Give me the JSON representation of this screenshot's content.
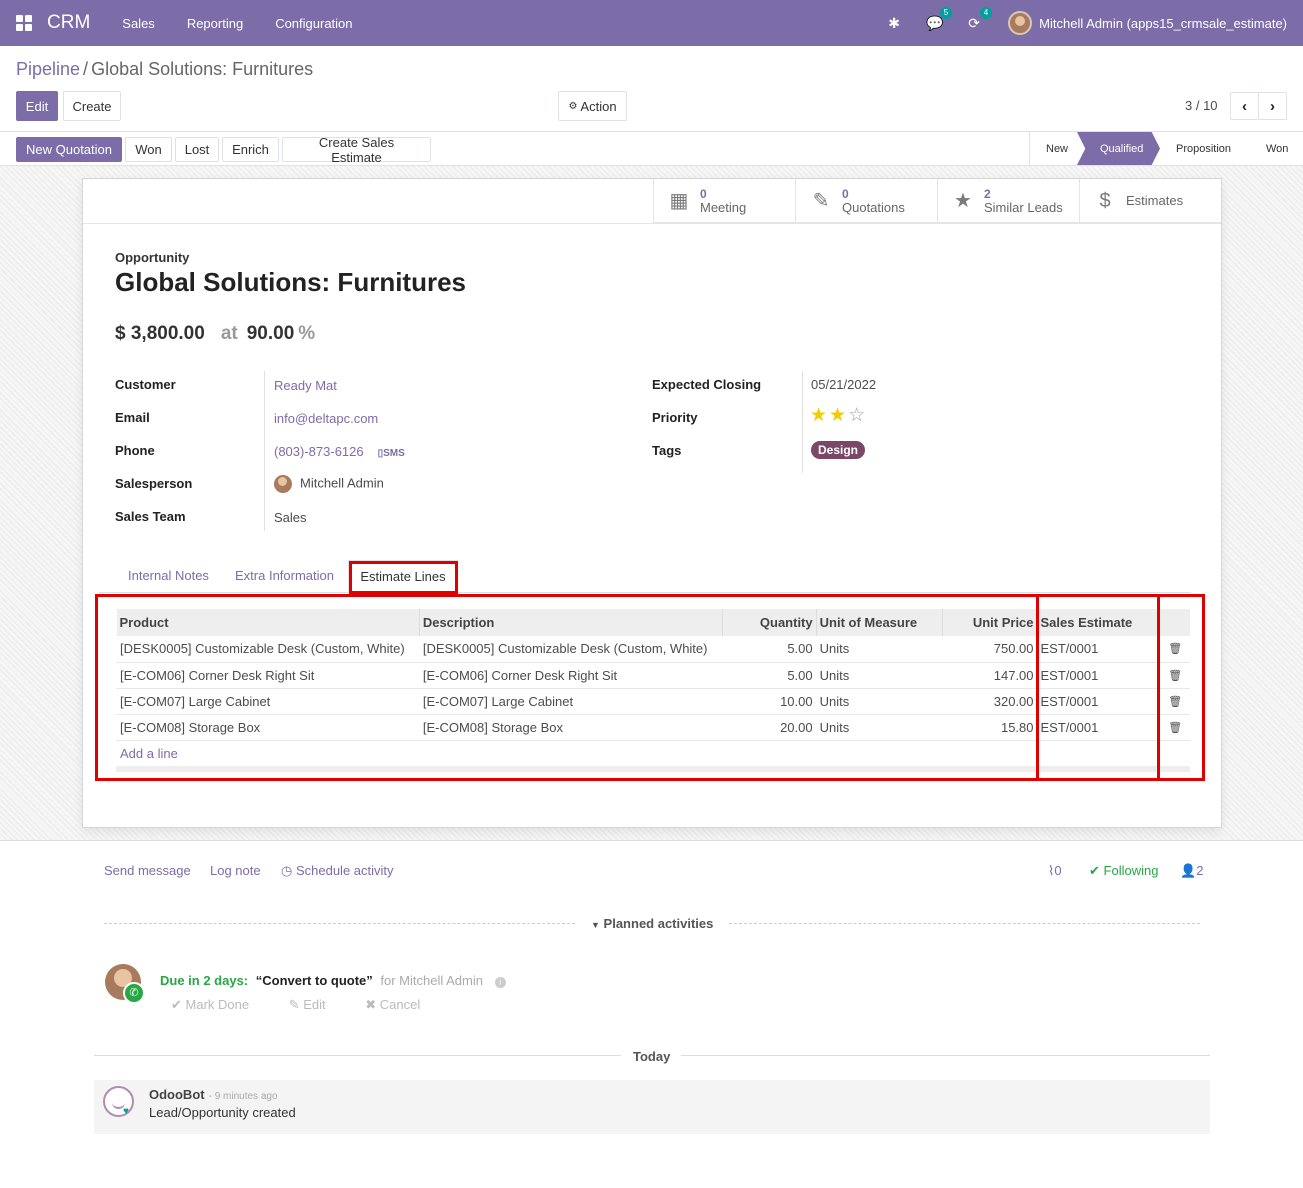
{
  "navbar": {
    "brand": "CRM",
    "menus": [
      "Sales",
      "Reporting",
      "Configuration"
    ],
    "messages_count": "5",
    "activities_count": "4",
    "user_name": "Mitchell Admin (apps15_crmsale_estimate)"
  },
  "breadcrumb": {
    "parent": "Pipeline",
    "separator": "/",
    "current": "Global Solutions: Furnitures"
  },
  "controls": {
    "edit": "Edit",
    "create": "Create",
    "action": "Action",
    "pager": "3 / 10"
  },
  "header_buttons": {
    "new_quotation": "New Quotation",
    "won": "Won",
    "lost": "Lost",
    "enrich": "Enrich",
    "create_estimate": "Create Sales Estimate"
  },
  "stages": [
    "New",
    "Qualified",
    "Proposition",
    "Won"
  ],
  "stat_buttons": {
    "meeting": {
      "count": "0",
      "label": "Meeting"
    },
    "quotations": {
      "count": "0",
      "label": "Quotations"
    },
    "similar": {
      "count": "2",
      "label": "Similar Leads"
    },
    "estimates": {
      "label": "Estimates"
    }
  },
  "record": {
    "type_label": "Opportunity",
    "title": "Global Solutions: Furnitures",
    "revenue": "$ 3,800.00",
    "at": "at",
    "probability": "90.00",
    "pct": "%"
  },
  "fields": {
    "customer_label": "Customer",
    "customer": "Ready Mat",
    "email_label": "Email",
    "email": "info@deltapc.com",
    "phone_label": "Phone",
    "phone": "(803)-873-6126",
    "sms": "SMS",
    "salesperson_label": "Salesperson",
    "salesperson": "Mitchell Admin",
    "team_label": "Sales Team",
    "team": "Sales",
    "closing_label": "Expected Closing",
    "closing": "05/21/2022",
    "priority_label": "Priority",
    "priority_stars": 2,
    "priority_max": 3,
    "tags_label": "Tags",
    "tag": "Design"
  },
  "tabs": {
    "internal_notes": "Internal Notes",
    "extra_info": "Extra Information",
    "estimate_lines": "Estimate Lines"
  },
  "estimate_table": {
    "headers": {
      "product": "Product",
      "description": "Description",
      "quantity": "Quantity",
      "uom": "Unit of Measure",
      "price": "Unit Price",
      "estimate": "Sales Estimate"
    },
    "rows": [
      {
        "product": "[DESK0005] Customizable Desk (Custom, White)",
        "description": "[DESK0005] Customizable Desk (Custom, White)",
        "quantity": "5.00",
        "uom": "Units",
        "price": "750.00",
        "estimate": "EST/0001"
      },
      {
        "product": "[E-COM06] Corner Desk Right Sit",
        "description": "[E-COM06] Corner Desk Right Sit",
        "quantity": "5.00",
        "uom": "Units",
        "price": "147.00",
        "estimate": "EST/0001"
      },
      {
        "product": "[E-COM07] Large Cabinet",
        "description": "[E-COM07] Large Cabinet",
        "quantity": "10.00",
        "uom": "Units",
        "price": "320.00",
        "estimate": "EST/0001"
      },
      {
        "product": "[E-COM08] Storage Box",
        "description": "[E-COM08] Storage Box",
        "quantity": "20.00",
        "uom": "Units",
        "price": "15.80",
        "estimate": "EST/0001"
      }
    ],
    "add_line": "Add a line"
  },
  "chatter": {
    "send_message": "Send message",
    "log_note": "Log note",
    "schedule_activity": "Schedule activity",
    "attachments": "0",
    "following": "Following",
    "followers": "2",
    "planned": "Planned activities",
    "activity": {
      "due": "Due in 2 days:",
      "summary": "“Convert to quote”",
      "for": "for Mitchell Admin",
      "mark_done": "Mark Done",
      "edit": "Edit",
      "cancel": "Cancel"
    },
    "today": "Today",
    "message": {
      "author": "OdooBot",
      "time": "- 9 minutes ago",
      "body": "Lead/Opportunity created"
    }
  },
  "colors": {
    "brand": "#7c6da8",
    "highlight": "#e00000",
    "tag": "#7b4766",
    "success": "#28a745"
  }
}
